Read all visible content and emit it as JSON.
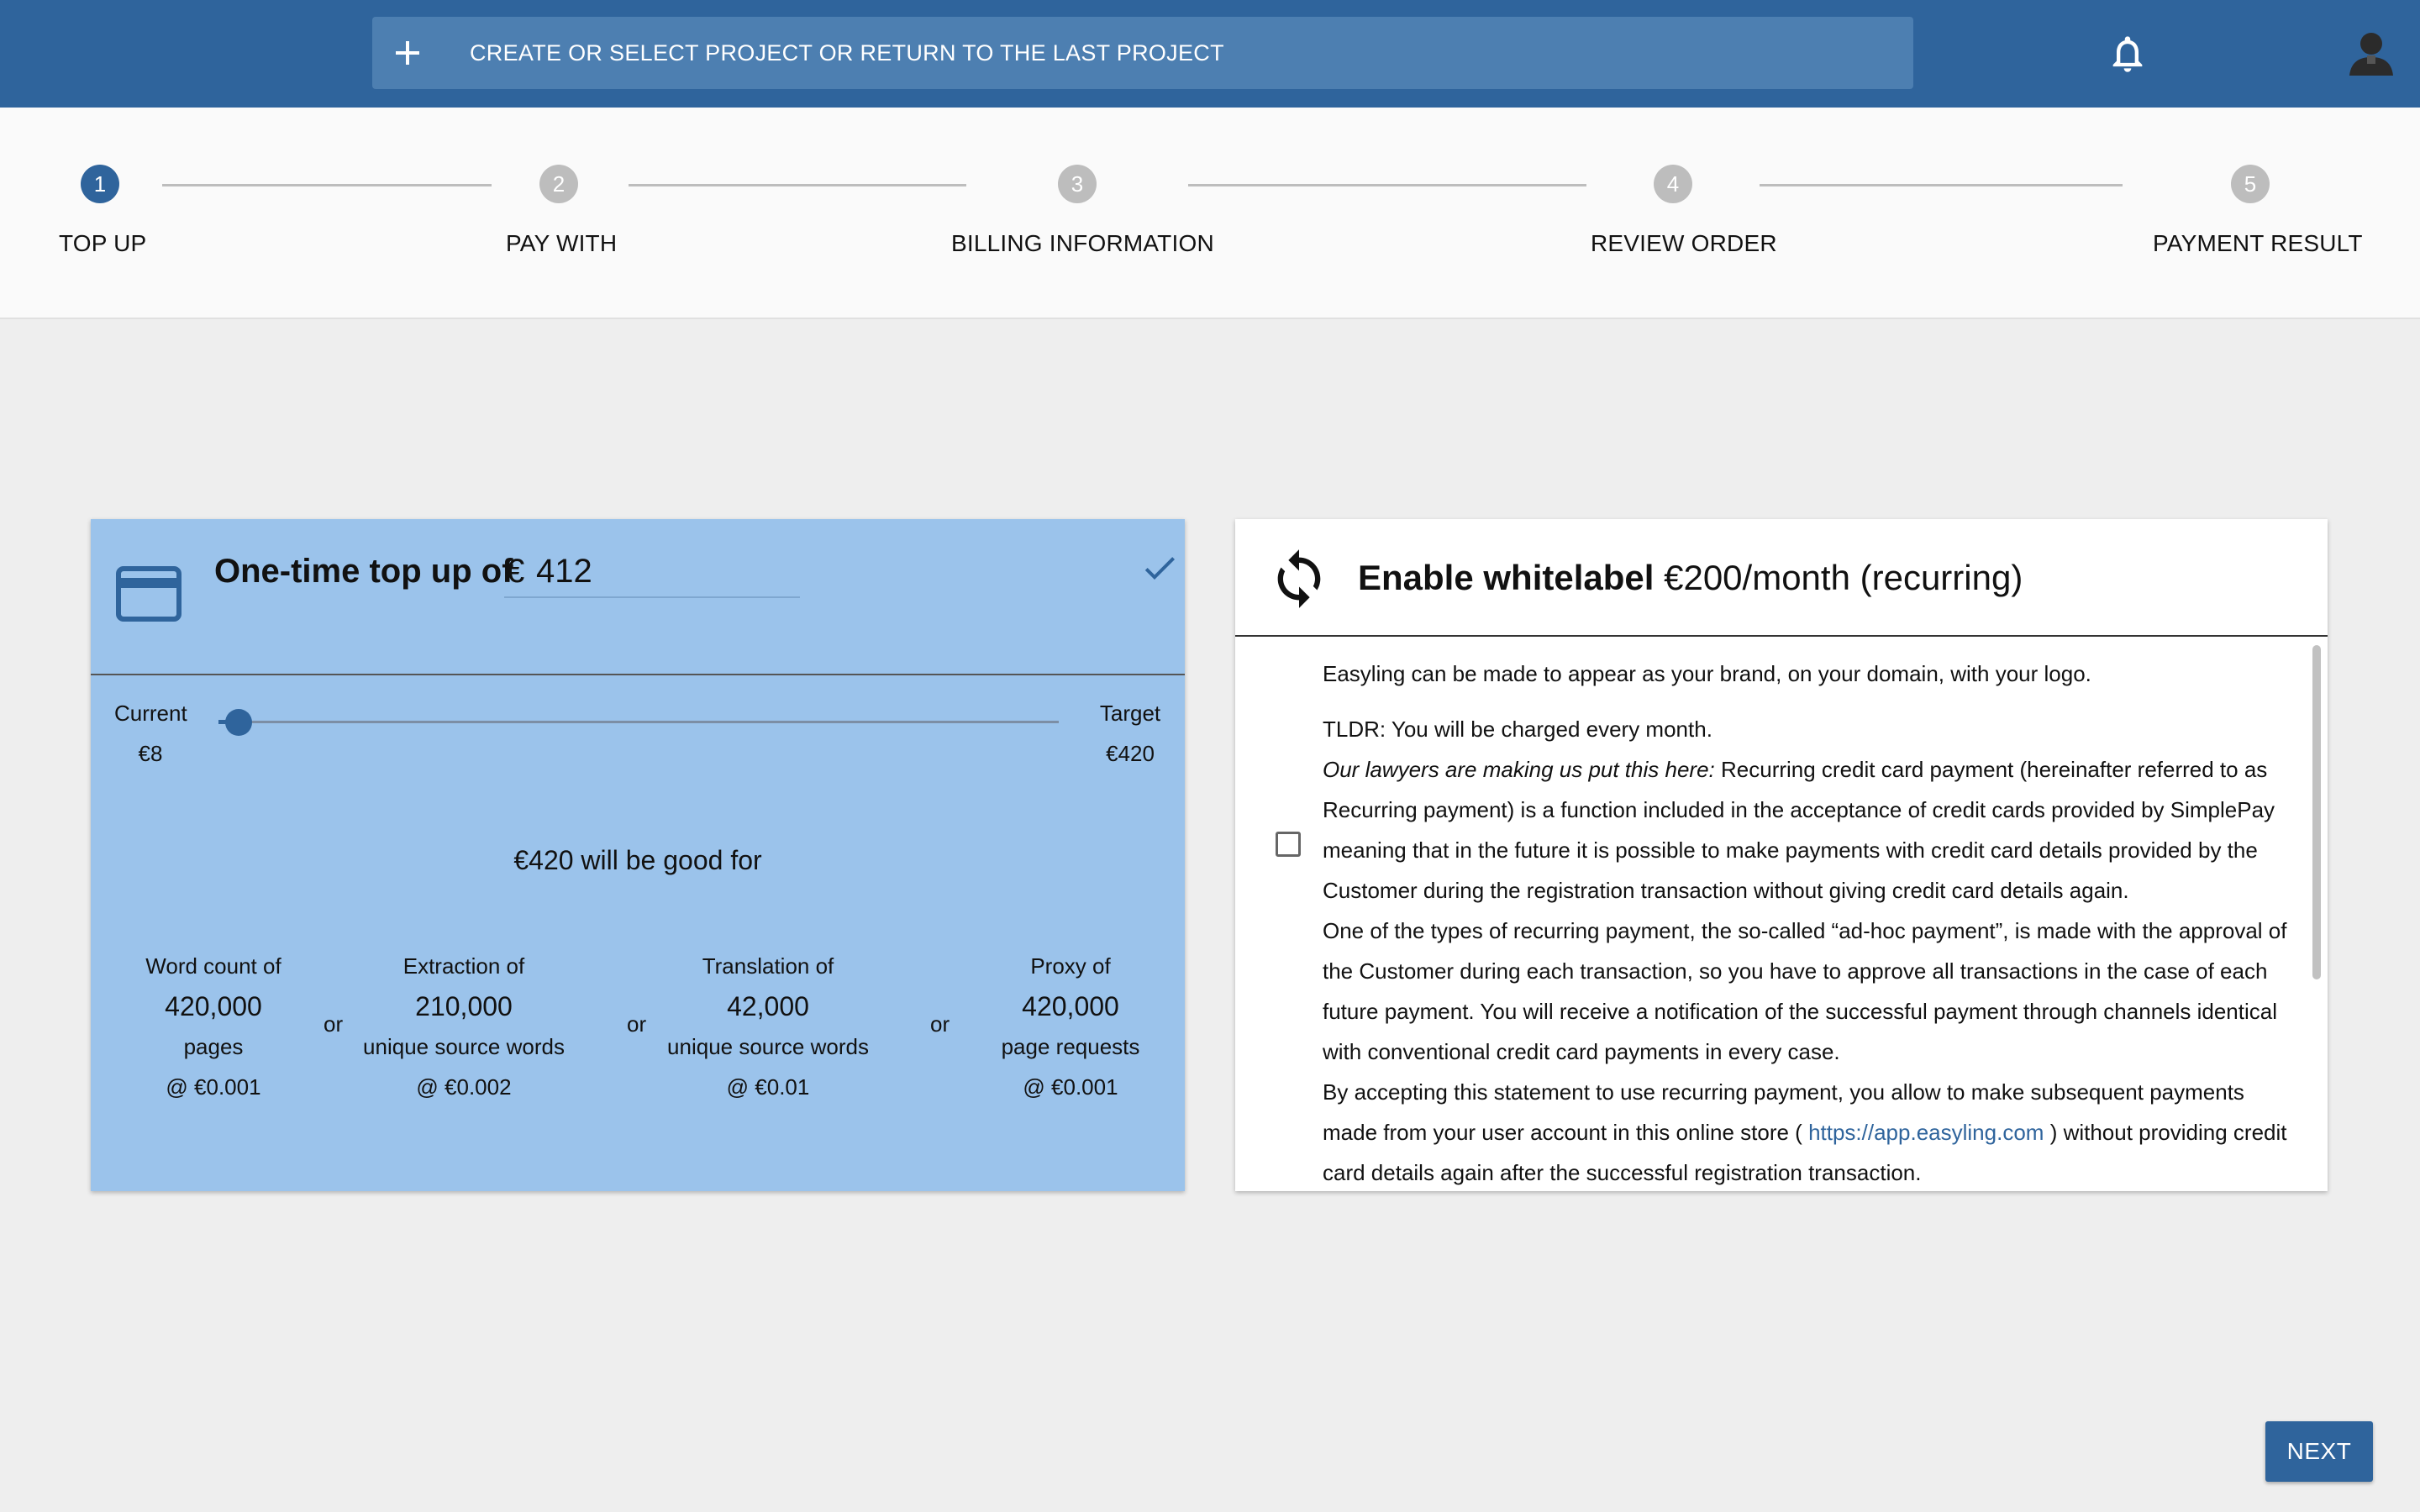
{
  "topbar": {
    "project_button_label": "CREATE OR SELECT PROJECT OR RETURN TO THE LAST PROJECT",
    "icons": [
      "plus-icon",
      "bell-icon",
      "user-avatar-icon"
    ],
    "background_color": "#2f649c"
  },
  "stepper": {
    "active_step": 1,
    "steps": [
      {
        "number": "1",
        "label": "TOP UP"
      },
      {
        "number": "2",
        "label": "PAY WITH"
      },
      {
        "number": "3",
        "label": "BILLING INFORMATION"
      },
      {
        "number": "4",
        "label": "REVIEW ORDER"
      },
      {
        "number": "5",
        "label": "PAYMENT RESULT"
      }
    ]
  },
  "topup": {
    "title": "One-time top up of",
    "currency_prefix": "€",
    "amount_value": "412",
    "selected": true,
    "slider": {
      "current_label": "Current",
      "current_value": "€8",
      "target_label": "Target",
      "target_value": "€420",
      "position_fraction": 0.01
    },
    "good_for": "€420 will be good for",
    "or_label": "or",
    "stats": [
      {
        "title": "Word count of",
        "value": "420,000",
        "unit": "pages",
        "rate": "@ €0.001"
      },
      {
        "title": "Extraction of",
        "value": "210,000",
        "unit": "unique source words",
        "rate": "@ €0.002"
      },
      {
        "title": "Translation of",
        "value": "42,000",
        "unit": "unique source words",
        "rate": "@ €0.01"
      },
      {
        "title": "Proxy of",
        "value": "420,000",
        "unit": "page requests",
        "rate": "@ €0.001"
      }
    ],
    "background_color": "#9bc3eb"
  },
  "whitelabel": {
    "title_bold": "Enable whitelabel",
    "title_rest": "€200/month (recurring)",
    "intro": "Easyling can be made to appear as your brand, on your domain, with your logo.",
    "checkbox_checked": false,
    "tldr": "TLDR: You will be charged every month.",
    "lawyers_italic": "Our lawyers are making us put this here:",
    "para1": "Recurring credit card payment (hereinafter referred to as Recurring payment) is a function included in the acceptance of credit cards provided by SimplePay meaning that in the future it is possible to make payments with credit card details provided by the Customer during the registration transaction without giving credit card details again.",
    "para2": "One of the types of recurring payment, the so-called “ad-hoc payment”, is made with the approval of the Customer during each transaction, so you have to approve all transactions in the case of each future payment. You will receive a notification of the successful payment through channels identical with conventional credit card payments in every case.",
    "para3_start": "By accepting this statement to use recurring payment, you allow to make subsequent payments made from your user account in this online store (",
    "para3_link": "https://app.easyling.com",
    "para3_end": ") without providing credit card details again after the successful registration transaction."
  },
  "footer": {
    "next_label": "NEXT"
  }
}
